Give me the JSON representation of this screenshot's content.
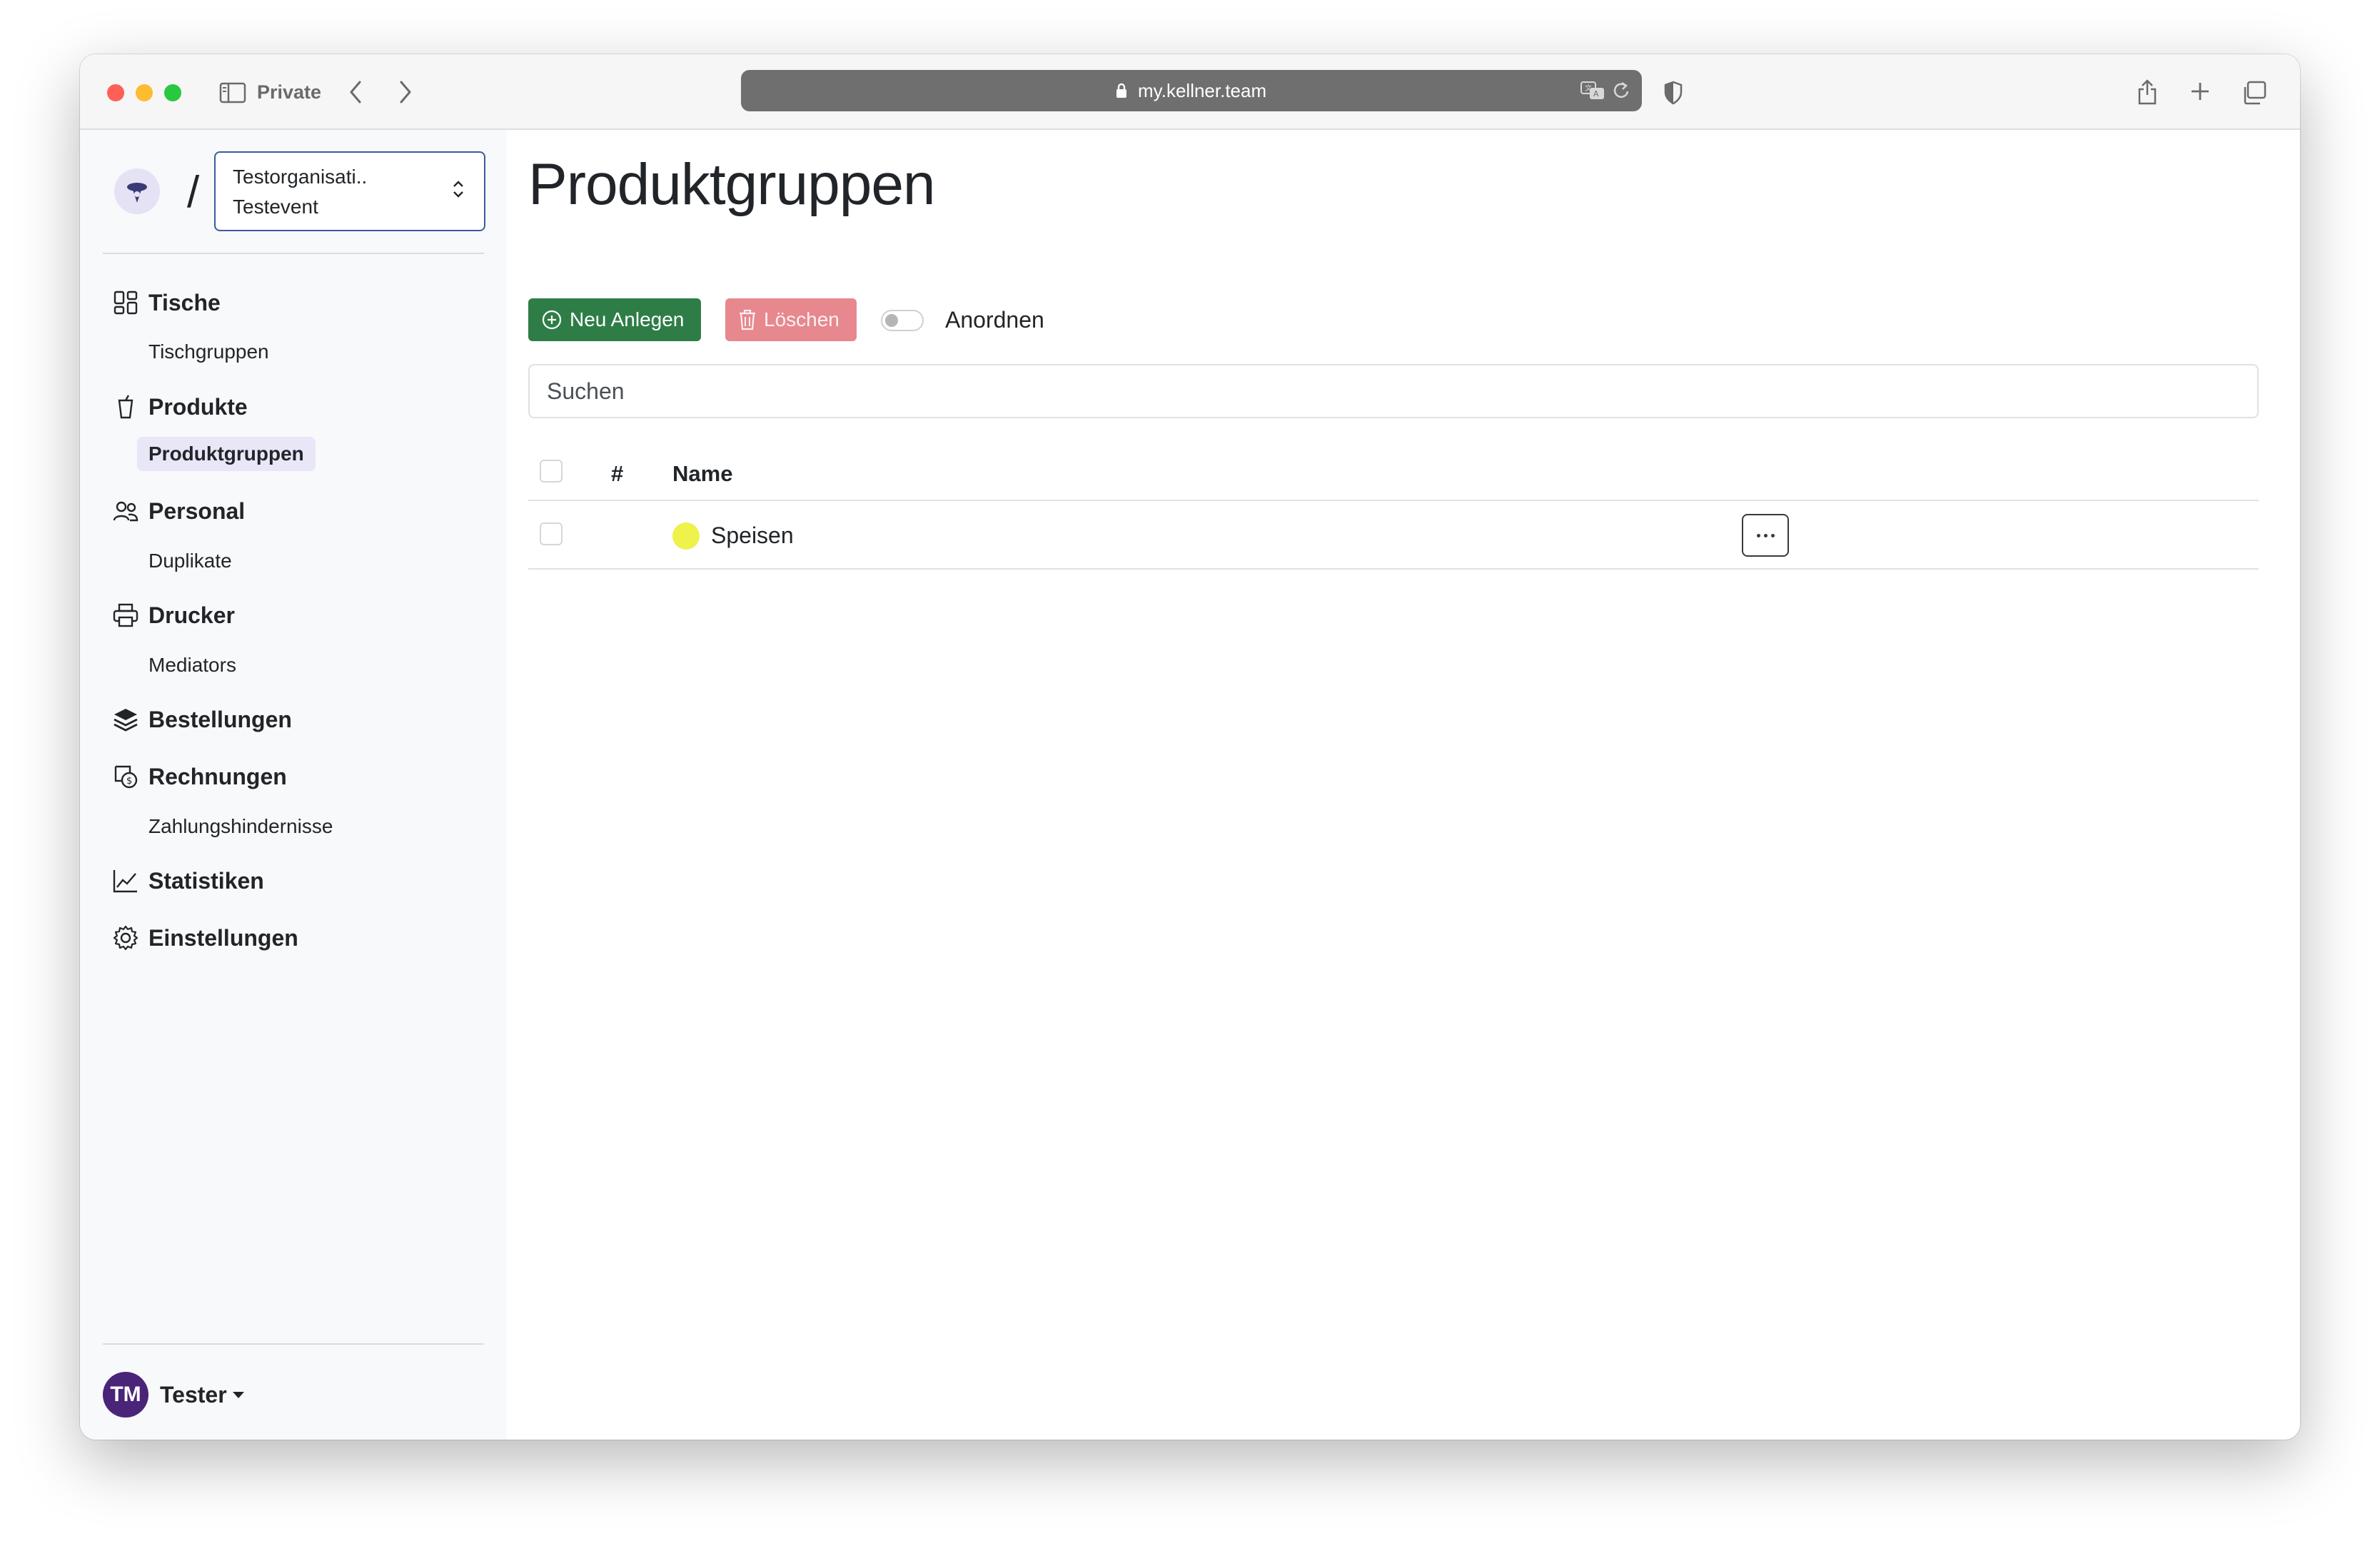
{
  "browser": {
    "private_label": "Private",
    "url": "my.kellner.team"
  },
  "sidebar": {
    "org_name": "Testorganisati..",
    "event_name": "Testevent",
    "slash": "/",
    "items": [
      {
        "label": "Tische",
        "icon": "grid-icon",
        "sub": "Tischgruppen"
      },
      {
        "label": "Produkte",
        "icon": "cup-icon",
        "sub": "Produktgruppen"
      },
      {
        "label": "Personal",
        "icon": "people-icon",
        "sub": "Duplikate"
      },
      {
        "label": "Drucker",
        "icon": "printer-icon",
        "sub": "Mediators"
      },
      {
        "label": "Bestellungen",
        "icon": "layers-icon"
      },
      {
        "label": "Rechnungen",
        "icon": "receipt-icon",
        "sub": "Zahlungshindernisse"
      },
      {
        "label": "Statistiken",
        "icon": "chart-line-icon"
      },
      {
        "label": "Einstellungen",
        "icon": "gear-icon"
      }
    ],
    "user": {
      "initials": "TM",
      "name": "Tester"
    }
  },
  "main": {
    "title": "Produktgruppen",
    "new_button": "Neu Anlegen",
    "delete_button": "Löschen",
    "arrange_label": "Anordnen",
    "search_placeholder": "Suchen",
    "table": {
      "columns": [
        "#",
        "Name"
      ],
      "rows": [
        {
          "number": "",
          "name": "Speisen",
          "color": "#eef24b"
        }
      ]
    }
  },
  "colors": {
    "primary_green": "#2e7d47",
    "danger_light": "#e6888e",
    "user_avatar": "#4a2479",
    "active_nav": "#e9e6f8"
  }
}
